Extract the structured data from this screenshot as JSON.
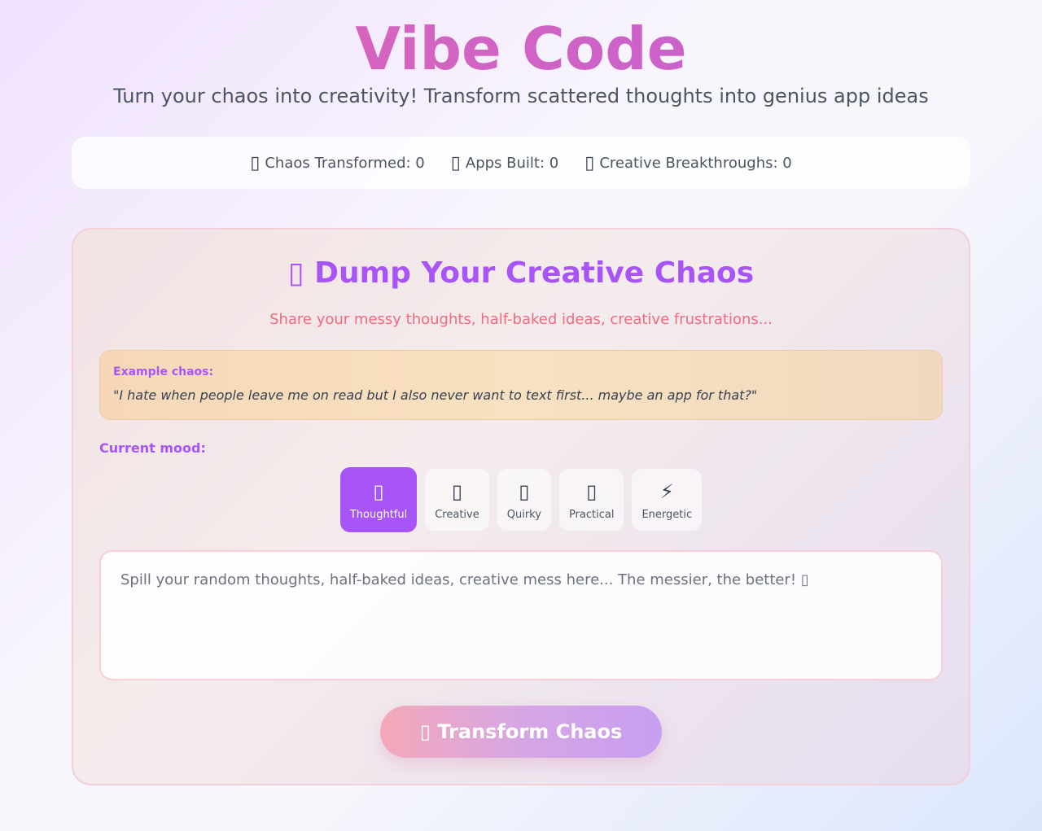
{
  "header": {
    "title": "Vibe Code",
    "subtitle": "Turn your chaos into creativity! Transform scattered thoughts into genius app ideas"
  },
  "stats": [
    {
      "icon": "chaos-icon",
      "glyph": "▯",
      "label": "Chaos Transformed: 0"
    },
    {
      "icon": "apps-icon",
      "glyph": "▯",
      "label": "Apps Built: 0"
    },
    {
      "icon": "breakthrough-icon",
      "glyph": "▯",
      "label": "Creative Breakthroughs: 0"
    }
  ],
  "card": {
    "title": "▯ Dump Your Creative Chaos",
    "subtitle": "Share your messy thoughts, half-baked ideas, creative frustrations...",
    "example_label": "Example chaos:",
    "example_text": "\"I hate when people leave me on read but I also never want to text first... maybe an app for that?\"",
    "mood_label": "Current mood:",
    "moods": [
      {
        "glyph": "▯",
        "label": "Thoughtful",
        "active": true
      },
      {
        "glyph": "▯",
        "label": "Creative",
        "active": false
      },
      {
        "glyph": "▯",
        "label": "Quirky",
        "active": false
      },
      {
        "glyph": "▯",
        "label": "Practical",
        "active": false
      },
      {
        "glyph": "⚡",
        "label": "Energetic",
        "active": false
      }
    ],
    "input_placeholder": "Spill your random thoughts, half-baked ideas, creative mess here... The messier, the better! ▯",
    "input_value": "",
    "submit_label": "▯ Transform Chaos"
  },
  "colors": {
    "accent": "#a855f7",
    "subtitle_pink": "#f06a80"
  }
}
